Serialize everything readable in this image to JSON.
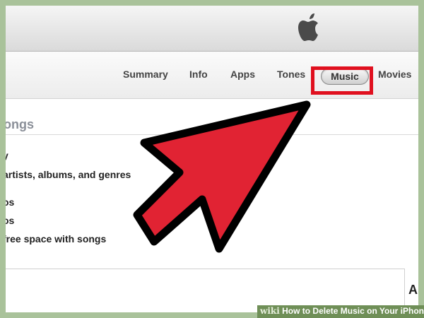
{
  "tabs": [
    {
      "id": "summary",
      "label": "Summary"
    },
    {
      "id": "info",
      "label": "Info"
    },
    {
      "id": "apps",
      "label": "Apps"
    },
    {
      "id": "tones",
      "label": "Tones"
    },
    {
      "id": "music",
      "label": "Music",
      "selected": true
    },
    {
      "id": "movies",
      "label": "Movies"
    }
  ],
  "section": {
    "title": "ongs",
    "options": [
      "y",
      "artists, albums, and genres",
      "os",
      "os",
      "free space with songs"
    ]
  },
  "lower_panel": {
    "side_letter": "A"
  },
  "watermark": {
    "brand": "wiki",
    "caption": "How to Delete Music on Your iPhone"
  },
  "colors": {
    "highlight": "#e0101f",
    "arrow_fill": "#e12333",
    "background": "#a9c29a"
  }
}
